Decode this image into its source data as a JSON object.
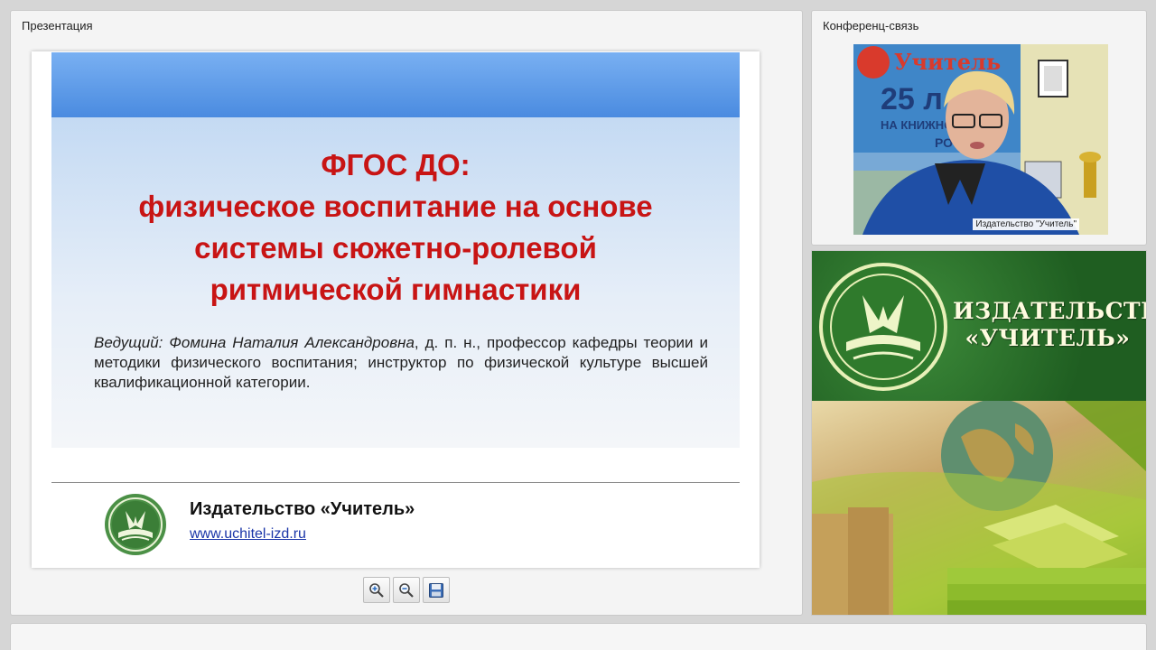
{
  "presentation": {
    "panel_title": "Презентация",
    "slide": {
      "title_lines": [
        "ФГОС ДО:",
        "физическое воспитание на основе",
        "системы сюжетно-ролевой",
        "ритмической гимнастики"
      ],
      "presenter_label": "Ведущий:",
      "presenter_name": "Фомина Наталия Александровна",
      "presenter_details": ", д. п. н., профессор кафедры теории и методики физического воспитания; инструктор по физической культуре высшей квалификационной категории.",
      "publisher_name": "Издательство «Учитель»",
      "publisher_url": "www.uchitel-izd.ru"
    },
    "toolbar": {
      "zoom_in_icon": "zoom-in-icon",
      "zoom_out_icon": "zoom-out-icon",
      "save_icon": "floppy-disk-icon"
    }
  },
  "conference": {
    "panel_title": "Конференц-связь",
    "video": {
      "participant_label": "Издательство \"Учитель\"",
      "background_poster": {
        "line1": "Учитель",
        "line2": "25 л",
        "line3": "НА КНИЖНО",
        "line4": "РО"
      }
    }
  },
  "banner": {
    "line1": "ИЗДАТЕЛЬСТВО",
    "line2": "«УЧИТЕЛЬ»"
  },
  "colors": {
    "title_red": "#c81414",
    "band_blue": "#4a8be0",
    "banner_green": "#2e7a2e",
    "link_blue": "#1a35a8"
  }
}
